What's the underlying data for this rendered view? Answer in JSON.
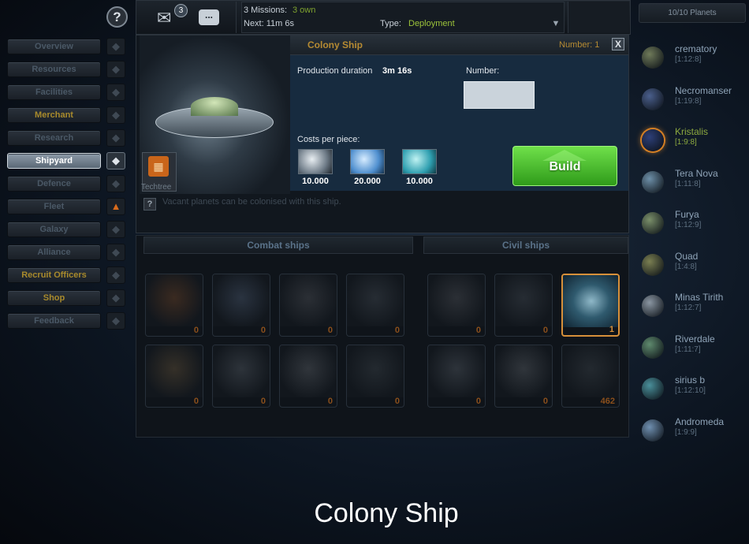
{
  "menu": {
    "items": [
      {
        "label": "Overview",
        "icon": "planet-icon"
      },
      {
        "label": "Resources",
        "icon": "mine-icon"
      },
      {
        "label": "Facilities",
        "icon": "factory-icon"
      },
      {
        "label": "Merchant",
        "icon": "trade-icon"
      },
      {
        "label": "Research",
        "icon": "flask-icon"
      },
      {
        "label": "Shipyard",
        "icon": "shipyard-icon"
      },
      {
        "label": "Defence",
        "icon": "defence-icon"
      },
      {
        "label": "Fleet",
        "icon": "fleet-icon"
      },
      {
        "label": "Galaxy",
        "icon": "galaxy-icon"
      },
      {
        "label": "Alliance",
        "icon": "alliance-icon"
      },
      {
        "label": "Recruit Officers",
        "icon": "officers-icon"
      },
      {
        "label": "Shop",
        "icon": "gift-icon"
      },
      {
        "label": "Feedback",
        "icon": "feedback-icon"
      }
    ],
    "active": "Shipyard",
    "gold_items": [
      "Merchant",
      "Recruit Officers",
      "Shop"
    ]
  },
  "header": {
    "mail_count": "3",
    "chat_glyph": "...",
    "missions_count": "3 Missions:",
    "missions_own": "3 own",
    "next": "Next: 11m 6s",
    "type_label": "Type:",
    "type_value": "Deployment"
  },
  "planets": {
    "header": "10/10 Planets",
    "list": [
      {
        "name": "crematory",
        "coords": "[1:12:8]",
        "color": "#6f7a5a"
      },
      {
        "name": "Necromanser",
        "coords": "[1:19:8]",
        "color": "#4a5f8c"
      },
      {
        "name": "Kristalis",
        "coords": "[1:9:8]",
        "color": "#2d3f78",
        "active": true
      },
      {
        "name": "Tera Nova",
        "coords": "[1:11:8]",
        "color": "#6d8fa8"
      },
      {
        "name": "Furya",
        "coords": "[1:12:9]",
        "color": "#7a8f6a"
      },
      {
        "name": "Quad",
        "coords": "[1:4:8]",
        "color": "#7a7f52"
      },
      {
        "name": "Minas Tirith",
        "coords": "[1:12:7]",
        "color": "#8a96a2"
      },
      {
        "name": "Riverdale",
        "coords": "[1:11:7]",
        "color": "#5f8a6e"
      },
      {
        "name": "sirius b",
        "coords": "[1:12:10]",
        "color": "#4a8f9a"
      },
      {
        "name": "Andromeda",
        "coords": "[1:9:9]",
        "color": "#6f8fb0"
      }
    ]
  },
  "detail": {
    "title": "Colony Ship",
    "number_top": "Number: 1",
    "close": "X",
    "production_label": "Production duration",
    "production_value": "3m 16s",
    "number_label": "Number:",
    "number_value": "",
    "costs_label": "Costs per piece:",
    "costs": [
      {
        "resource": "metal",
        "icon": "metal-icon",
        "value": "10.000"
      },
      {
        "resource": "crystal",
        "icon": "crystal-icon",
        "value": "20.000"
      },
      {
        "resource": "deuterium",
        "icon": "deuterium-icon",
        "value": "10.000"
      }
    ],
    "build": "Build",
    "techtree": "Techtree",
    "help": "?",
    "description": "Vacant planets can be colonised with this ship."
  },
  "lists": {
    "combat_label": "Combat ships",
    "civil_label": "Civil ships",
    "combat_ships": [
      {
        "count": "0"
      },
      {
        "count": "0"
      },
      {
        "count": "0"
      },
      {
        "count": "0"
      },
      {
        "count": "0"
      },
      {
        "count": "0"
      },
      {
        "count": "0"
      },
      {
        "count": "0"
      }
    ],
    "civil_ships": [
      {
        "count": "0"
      },
      {
        "count": "0"
      },
      {
        "count": "1",
        "selected": true
      },
      {
        "count": "0"
      },
      {
        "count": "0"
      },
      {
        "count": "462"
      }
    ]
  },
  "caption": "Colony Ship"
}
